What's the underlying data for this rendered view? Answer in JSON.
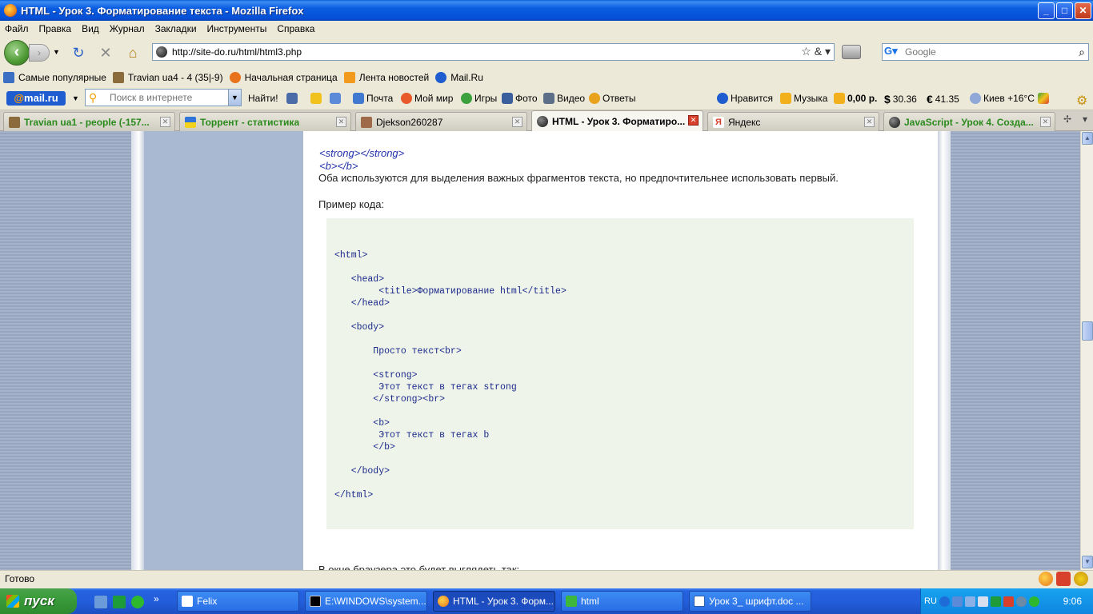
{
  "window": {
    "title": "HTML - Урок 3. Форматирование текста - Mozilla Firefox",
    "min_label": "_",
    "max_label": "□",
    "close_label": "✕"
  },
  "menu": [
    "Файл",
    "Правка",
    "Вид",
    "Журнал",
    "Закладки",
    "Инструменты",
    "Справка"
  ],
  "navigation": {
    "back_label": "‹",
    "forward_label": "›",
    "url": "http://site-do.ru/html/html3.php",
    "search_placeholder": "Google"
  },
  "bookmarks": [
    {
      "label": "Самые популярные",
      "color": "#3a6fc4"
    },
    {
      "label": "Travian ua4 - 4 (35|-9)",
      "color": "#8b6a3c"
    },
    {
      "label": "Начальная страница",
      "color": "#e8731c"
    },
    {
      "label": "Лента новостей",
      "color": "#f29a1e"
    },
    {
      "label": "Mail.Ru",
      "color": "#1e5cd0"
    }
  ],
  "mailru": {
    "logo_at": "@",
    "logo_text": "mail.ru",
    "search_placeholder": "Поиск в интернете",
    "find_label": "Найти!",
    "items": [
      {
        "label": "Почта"
      },
      {
        "label": "Мой мир"
      },
      {
        "label": "Игры"
      },
      {
        "label": "Фото"
      },
      {
        "label": "Видео"
      },
      {
        "label": "Ответы"
      },
      {
        "label": "Нравится"
      },
      {
        "label": "Музыка"
      },
      {
        "label": "0,00 р."
      },
      {
        "label": "30.36"
      },
      {
        "label": "41.35"
      },
      {
        "label": "Киев +16°C"
      }
    ]
  },
  "tabs": [
    {
      "label": "Travian ua1 - people (-157...",
      "active": false
    },
    {
      "label": "Торрент - статистика",
      "active": false
    },
    {
      "label": "Djekson260287",
      "active": false
    },
    {
      "label": "HTML - Урок 3. Форматиро...",
      "active": true
    },
    {
      "label": "Яндекс",
      "active": false
    },
    {
      "label": "JavaScript - Урок 4. Созда...",
      "active": false
    }
  ],
  "page": {
    "tags_line1": "<strong></strong>",
    "tags_line2": "<b></b>",
    "description": "Оба используются для выделения важных фрагментов текста, но предпочтительнее использовать первый.",
    "example_label": "Пример кода:",
    "code": "<html>\n\n   <head>\n        <title>Форматирование html</title>\n   </head>\n\n   <body>\n\n       Просто текст<br>\n\n       <strong>\n        Этот текст в тегах strong\n       </strong><br>\n\n       <b>\n        Этот текст в тегах b\n       </b>\n\n   </body>\n\n</html>",
    "after_text": "В окне браузера это будет выглядеть так:"
  },
  "status": {
    "text": "Готово"
  },
  "taskbar": {
    "start_label": "пуск",
    "tasks": [
      {
        "label": "Felix",
        "active": false
      },
      {
        "label": "E:\\WINDOWS\\system...",
        "active": false
      },
      {
        "label": "HTML - Урок 3. Форм...",
        "active": true
      },
      {
        "label": "html",
        "active": false
      },
      {
        "label": "Урок 3_ шрифт.doc ...",
        "active": false
      }
    ],
    "lang": "RU",
    "clock": "9:06"
  }
}
